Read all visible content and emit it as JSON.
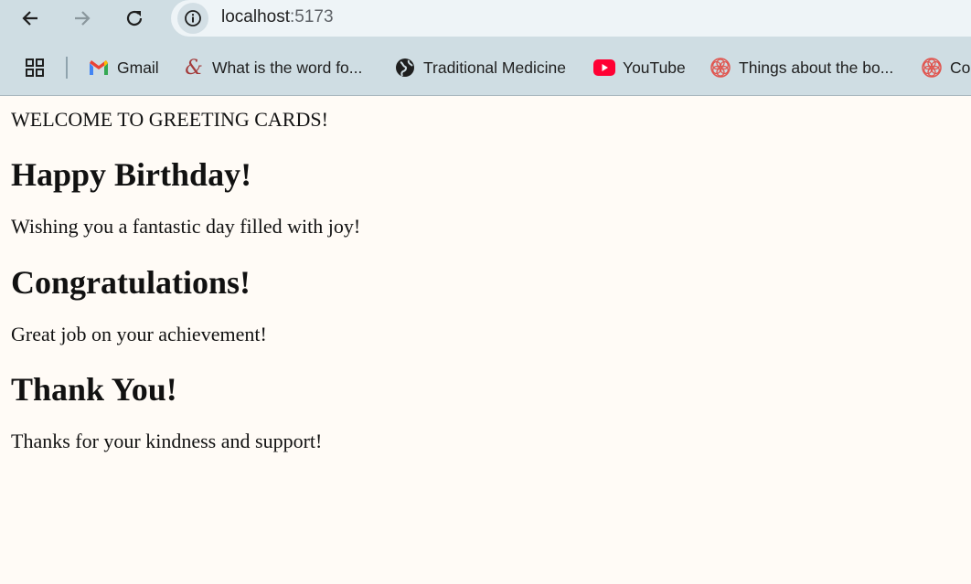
{
  "browser": {
    "url_host": "localhost",
    "url_port": ":5173",
    "bookmarks": [
      {
        "label": "Gmail",
        "icon": "gmail-icon"
      },
      {
        "label": "What is the word fo...",
        "icon": "ampersand-icon"
      },
      {
        "label": "Traditional Medicine",
        "icon": "globe-icon"
      },
      {
        "label": "YouTube",
        "icon": "youtube-icon"
      },
      {
        "label": "Things about the bo...",
        "icon": "flower-icon"
      },
      {
        "label": "Co",
        "icon": "flower-icon"
      }
    ]
  },
  "page": {
    "welcome": "WELCOME TO GREETING CARDS!",
    "cards": [
      {
        "title": "Happy Birthday!",
        "message": "Wishing you a fantastic day filled with joy!"
      },
      {
        "title": "Congratulations!",
        "message": "Great job on your achievement!"
      },
      {
        "title": "Thank You!",
        "message": "Thanks for your kindness and support!"
      }
    ]
  },
  "colors": {
    "toolbar_bg": "#cfdde3",
    "page_bg": "#fffbf6",
    "youtube_red": "#ff0033"
  }
}
